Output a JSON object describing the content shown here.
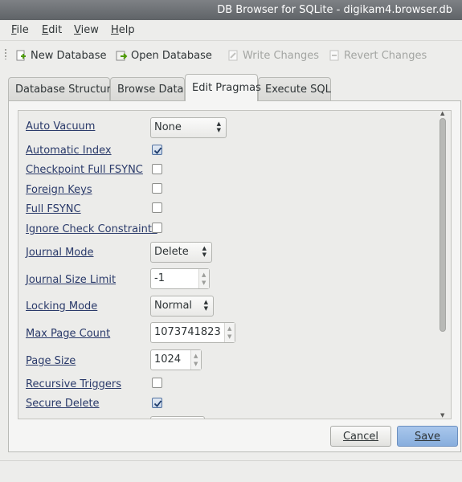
{
  "window": {
    "title": "DB Browser for SQLite - digikam4.browser.db"
  },
  "menu": [
    {
      "pre": "",
      "accel": "F",
      "post": "ile"
    },
    {
      "pre": "",
      "accel": "E",
      "post": "dit"
    },
    {
      "pre": "",
      "accel": "V",
      "post": "iew"
    },
    {
      "pre": "",
      "accel": "H",
      "post": "elp"
    }
  ],
  "toolbar": {
    "new_database": "New Database",
    "open_database": "Open Database",
    "write_changes": "Write Changes",
    "revert_changes": "Revert Changes"
  },
  "tabs": [
    "Database Structure",
    "Browse Data",
    "Edit Pragmas",
    "Execute SQL"
  ],
  "pragmas": {
    "auto_vacuum": {
      "label": "Auto Vacuum",
      "value": "None"
    },
    "automatic_index": {
      "label": "Automatic Index",
      "checked": true
    },
    "checkpoint_full_fsync": {
      "label": "Checkpoint Full FSYNC",
      "checked": false
    },
    "foreign_keys": {
      "label": "Foreign Keys",
      "checked": false
    },
    "full_fsync": {
      "label": "Full FSYNC",
      "checked": false
    },
    "ignore_check_constraints": {
      "label": "Ignore Check Constraints",
      "checked": false
    },
    "journal_mode": {
      "label": "Journal Mode",
      "value": "Delete"
    },
    "journal_size_limit": {
      "label": "Journal Size Limit",
      "value": "-1"
    },
    "locking_mode": {
      "label": "Locking Mode",
      "value": "Normal"
    },
    "max_page_count": {
      "label": "Max Page Count",
      "value": "1073741823"
    },
    "page_size": {
      "label": "Page Size",
      "value": "1024"
    },
    "recursive_triggers": {
      "label": "Recursive Triggers",
      "checked": false
    },
    "secure_delete": {
      "label": "Secure Delete",
      "checked": true
    }
  },
  "buttons": {
    "cancel": "Cancel",
    "save": "Save"
  }
}
